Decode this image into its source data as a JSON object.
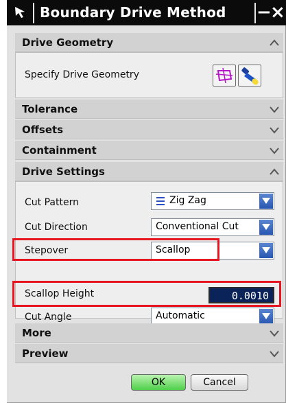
{
  "window": {
    "title": "Boundary Drive Method",
    "minimize_label": "−",
    "close_label": "×"
  },
  "groups": {
    "drive_geometry": {
      "label": "Drive Geometry",
      "row_label": "Specify Drive Geometry"
    },
    "tolerance": {
      "label": "Tolerance"
    },
    "offsets": {
      "label": "Offsets"
    },
    "containment": {
      "label": "Containment"
    },
    "drive_settings": {
      "label": "Drive Settings"
    },
    "more": {
      "label": "More"
    },
    "preview": {
      "label": "Preview"
    }
  },
  "drive_settings": {
    "cut_pattern": {
      "label": "Cut Pattern",
      "value": "Zig Zag"
    },
    "cut_direction": {
      "label": "Cut Direction",
      "value": "Conventional Cut"
    },
    "stepover": {
      "label": "Stepover",
      "value": "Scallop"
    },
    "scallop_height": {
      "label": "Scallop Height",
      "value": "0.0010"
    },
    "cut_angle": {
      "label": "Cut Angle",
      "value": "Automatic"
    }
  },
  "buttons": {
    "ok": "OK",
    "cancel": "Cancel"
  },
  "colors": {
    "highlight": "#e5161f",
    "ok_green": "#4fcf4a",
    "field_navy": "#0a2358"
  }
}
